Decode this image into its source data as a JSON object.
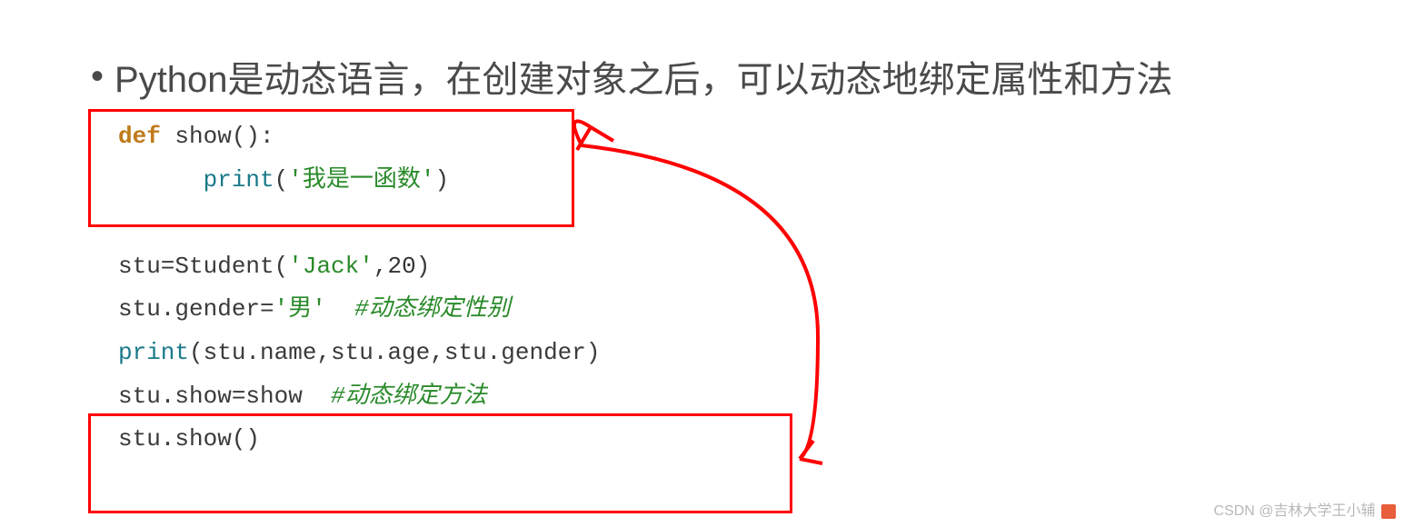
{
  "bullet": {
    "dot": "•",
    "text": "Python是动态语言，在创建对象之后，可以动态地绑定属性和方法"
  },
  "code": {
    "line1_def": "def ",
    "line1_rest": "show():",
    "line2_indent": "      ",
    "line2_print": "print",
    "line2_paren_open": "(",
    "line2_str": "'我是一函数'",
    "line2_paren_close": ")",
    "line3": " ",
    "line4_a": "stu=Student(",
    "line4_str": "'Jack'",
    "line4_comma": ",",
    "line4_num": "20",
    "line4_close": ")",
    "line5_a": "stu.gender=",
    "line5_str": "'男'",
    "line5_sp": "  ",
    "line5_comment": "#动态绑定性别",
    "line6_print": "print",
    "line6_rest": "(stu.name,stu.age,stu.gender)",
    "line7_a": "stu.show=show  ",
    "line7_comment": "#动态绑定方法",
    "line8": "stu.show()"
  },
  "watermark": {
    "text": "CSDN @吉林大学王小辅"
  }
}
